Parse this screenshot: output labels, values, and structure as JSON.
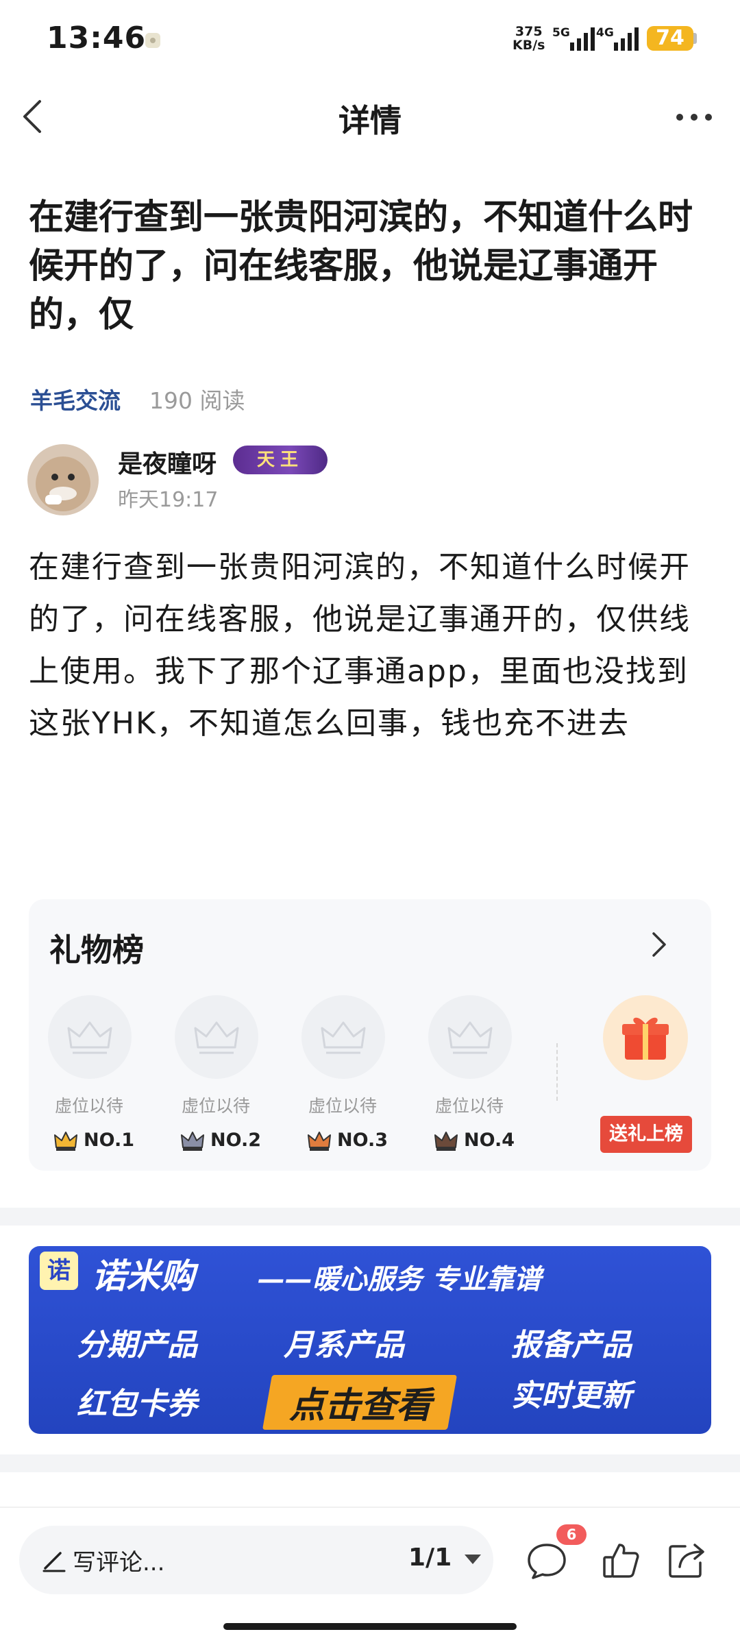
{
  "status_bar": {
    "time": "13:46",
    "net_speed_value": "375",
    "net_speed_unit": "KB/s",
    "sig1": "5G",
    "sig2": "4G",
    "battery": "74"
  },
  "nav": {
    "title": "详情",
    "back_icon": "chevron-left-icon",
    "more_icon": "more-dots-icon"
  },
  "post": {
    "title": "在建行查到一张贵阳河滨的，不知道什么时候开的了，问在线客服，他说是辽事通开的，仅",
    "channel": "羊毛交流",
    "reads": "190 阅读",
    "author": "是夜瞳呀",
    "author_badge": "天王",
    "time": "昨天19:17",
    "body": "在建行查到一张贵阳河滨的，不知道什么时候开的了，问在线客服，他说是辽事通开的，仅供线上使用。我下了那个辽事通app，里面也没找到这张YHK，不知道怎么回事，钱也充不进去"
  },
  "gift_board": {
    "title": "礼物榜",
    "slots": [
      {
        "label": "虚位以待",
        "rank": "NO.1",
        "crown": "#f2b634"
      },
      {
        "label": "虚位以待",
        "rank": "NO.2",
        "crown": "#8a8fa6"
      },
      {
        "label": "虚位以待",
        "rank": "NO.3",
        "crown": "#e07c3e"
      },
      {
        "label": "虚位以待",
        "rank": "NO.4",
        "crown": "#6b4a3a"
      }
    ],
    "button": "送礼上榜",
    "gift_icon": "gift-box-icon"
  },
  "banner": {
    "logo_char": "诺",
    "brand": "诺米购",
    "slogan": "——暖心服务 专业靠谱",
    "items": [
      "分期产品",
      "月系产品",
      "报备产品",
      "红包卡券",
      "实时更新"
    ],
    "cta": "点击查看"
  },
  "bottom_bar": {
    "comment_placeholder": "写评论...",
    "page": "1/1",
    "comment_count": "6",
    "icons": [
      "comment-icon",
      "like-icon",
      "share-icon"
    ]
  }
}
